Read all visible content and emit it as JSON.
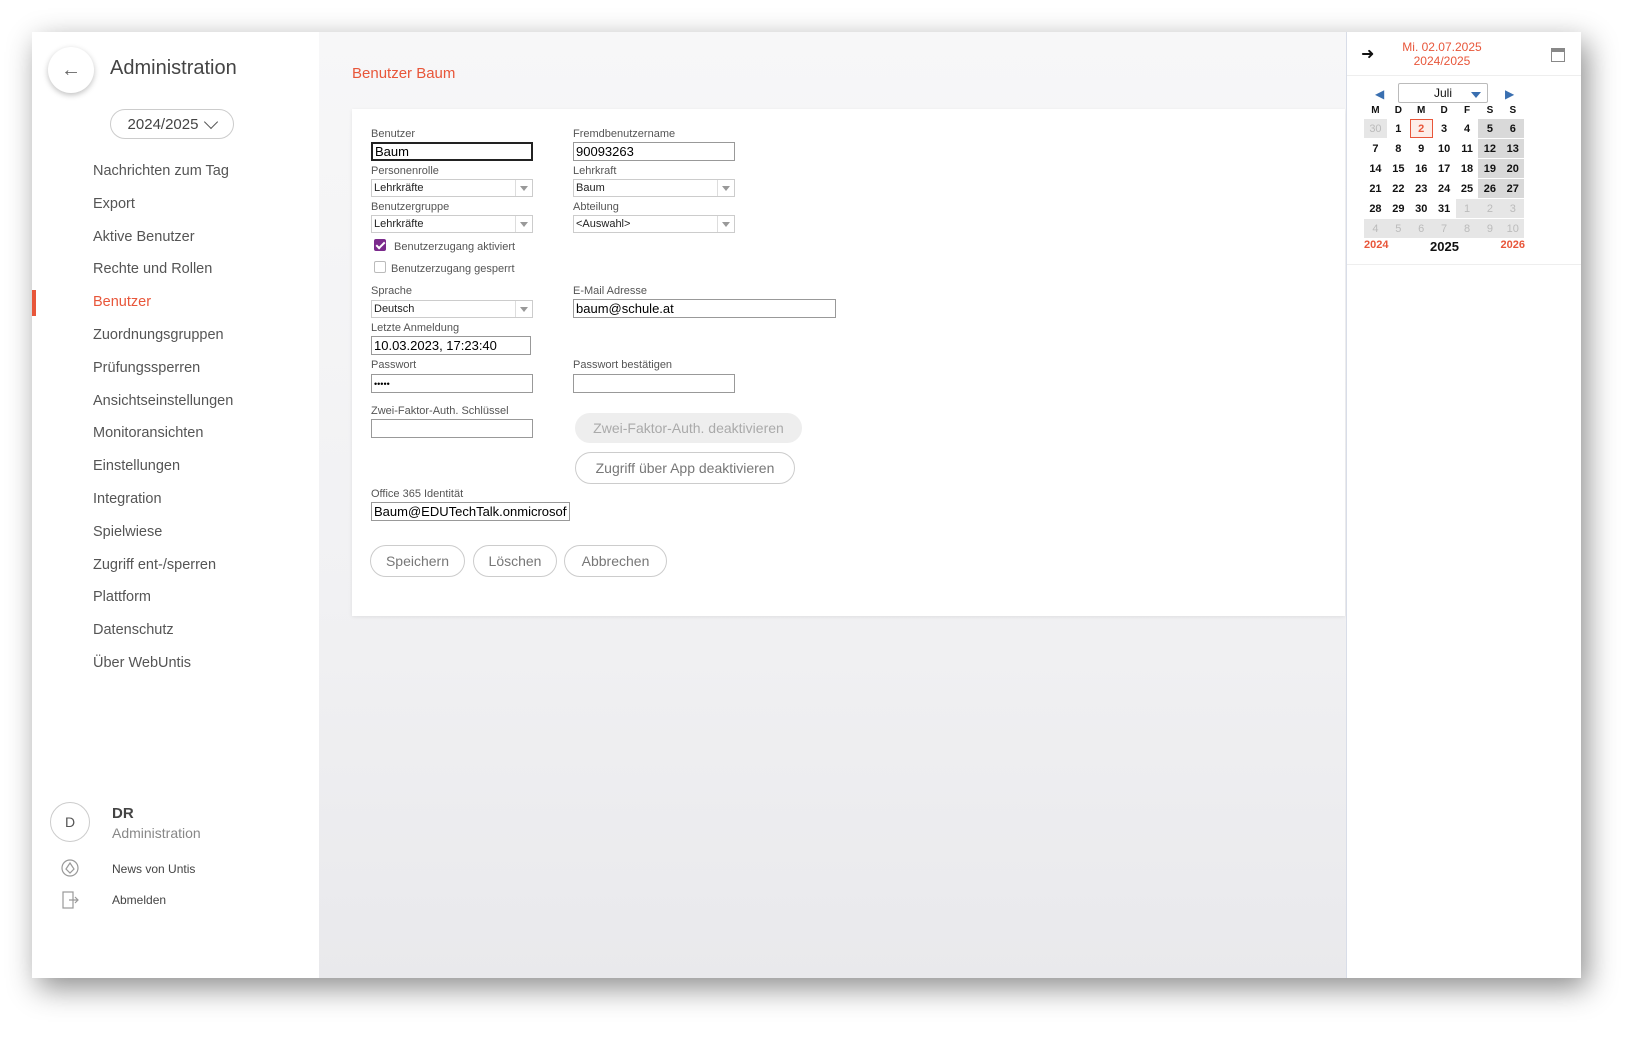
{
  "sidebar": {
    "title": "Administration",
    "back_icon": "arrow-left-icon",
    "year": "2024/2025",
    "items": [
      {
        "label": "Nachrichten zum Tag"
      },
      {
        "label": "Export"
      },
      {
        "label": "Aktive Benutzer"
      },
      {
        "label": "Rechte und Rollen"
      },
      {
        "label": "Benutzer",
        "active": true
      },
      {
        "label": "Zuordnungsgruppen"
      },
      {
        "label": "Prüfungssperren"
      },
      {
        "label": "Ansichtseinstellungen"
      },
      {
        "label": "Monitoransichten"
      },
      {
        "label": "Einstellungen"
      },
      {
        "label": "Integration"
      },
      {
        "label": "Spielwiese"
      },
      {
        "label": "Zugriff ent-/sperren"
      },
      {
        "label": "Plattform"
      },
      {
        "label": "Datenschutz"
      },
      {
        "label": "Über WebUntis"
      }
    ],
    "user": {
      "initial": "D",
      "name": "DR",
      "role": "Administration"
    },
    "news_label": "News von Untis",
    "logout_label": "Abmelden",
    "accent": "#e8563a"
  },
  "main": {
    "page_title": "Benutzer Baum",
    "form": {
      "benutzer_label": "Benutzer",
      "benutzer_value": "Baum",
      "fremd_label": "Fremdbenutzername",
      "fremd_value": "90093263",
      "personenrolle_label": "Personenrolle",
      "personenrolle_value": "Lehrkräfte",
      "lehrkraft_label": "Lehrkraft",
      "lehrkraft_value": "Baum",
      "benutzergruppe_label": "Benutzergruppe",
      "benutzergruppe_value": "Lehrkräfte",
      "abteilung_label": "Abteilung",
      "abteilung_value": "<Auswahl>",
      "zugang_aktiviert_label": "Benutzerzugang aktiviert",
      "zugang_aktiviert_checked": true,
      "zugang_gesperrt_label": "Benutzerzugang gesperrt",
      "zugang_gesperrt_checked": false,
      "sprache_label": "Sprache",
      "sprache_value": "Deutsch",
      "email_label": "E-Mail Adresse",
      "email_value": "baum@schule.at",
      "letzte_label": "Letzte Anmeldung",
      "letzte_value": "10.03.2023, 17:23:40",
      "passwort_label": "Passwort",
      "passwort_value": "•••••",
      "passwort_bestaetigen_label": "Passwort bestätigen",
      "passwort_bestaetigen_value": "",
      "zweifaktor_label": "Zwei-Faktor-Auth. Schlüssel",
      "zweifaktor_value": "",
      "zweifaktor_btn": "Zwei-Faktor-Auth. deaktivieren",
      "app_btn": "Zugriff über App deaktivieren",
      "office_label": "Office 365 Identität",
      "office_value": "Baum@EDUTechTalk.onmicrosoft"
    },
    "buttons": {
      "save": "Speichern",
      "delete": "Löschen",
      "cancel": "Abbrechen"
    }
  },
  "calendar": {
    "date": "Mi. 02.07.2025",
    "school_year": "2024/2025",
    "month": "Juli",
    "weekdays": [
      "M",
      "D",
      "M",
      "D",
      "F",
      "S",
      "S"
    ],
    "weeks": [
      [
        "30",
        "1",
        "2",
        "3",
        "4",
        "5",
        "6"
      ],
      [
        "7",
        "8",
        "9",
        "10",
        "11",
        "12",
        "13"
      ],
      [
        "14",
        "15",
        "16",
        "17",
        "18",
        "19",
        "20"
      ],
      [
        "21",
        "22",
        "23",
        "24",
        "25",
        "26",
        "27"
      ],
      [
        "28",
        "29",
        "30",
        "31",
        "1",
        "2",
        "3"
      ],
      [
        "4",
        "5",
        "6",
        "7",
        "8",
        "9",
        "10"
      ]
    ],
    "today": "2",
    "years": [
      "2024",
      "2025",
      "2026"
    ],
    "current_year": "2025"
  }
}
